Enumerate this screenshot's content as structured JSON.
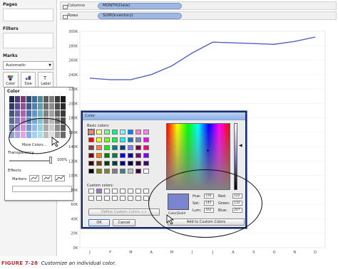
{
  "left": {
    "pages_title": "Pages",
    "filters_title": "Filters",
    "marks_title": "Marks",
    "mark_type": "Automatic",
    "buttons": [
      {
        "label": "Color",
        "icon": "color-palette-icon"
      },
      {
        "label": "Size",
        "icon": "size-icon"
      },
      {
        "label": "Label",
        "icon": "label-icon"
      }
    ]
  },
  "shelves": {
    "columns_label": "Columns",
    "columns_pill": "MONTH(Date)",
    "rows_label": "Rows",
    "rows_pill": "SUM(Inventory)"
  },
  "color_popup": {
    "title": "Color",
    "more_colors": "More Colors...",
    "transparency_label": "Transparency",
    "transparency_value": "100%",
    "effects_label": "Effects",
    "markers_label": "Markers:",
    "palette": [
      "#1f2a44",
      "#4a3a7a",
      "#7a3a7a",
      "#2a4a7a",
      "#3a6ea5",
      "#4a8a9a",
      "#5a5a5a",
      "#7a7a7a",
      "#3a3a3a",
      "#1a1a1a",
      "#2e3d6b",
      "#5a4a9a",
      "#9a4a9a",
      "#3a5a9a",
      "#4a82c0",
      "#5aa0b0",
      "#6e6e6e",
      "#8e8e8e",
      "#4e4e4e",
      "#2a2a2a",
      "#44557f",
      "#7060b0",
      "#b060b0",
      "#4a70b0",
      "#5c96d4",
      "#6ab4c4",
      "#828282",
      "#a2a2a2",
      "#626262",
      "#3a3a3a",
      "#5a6c96",
      "#8674c4",
      "#c476c4",
      "#5e84c4",
      "#70aae6",
      "#7ac6d6",
      "#969696",
      "#b6b6b6",
      "#767676",
      "#4a4a4a",
      "#7286ae",
      "#9c8ad6",
      "#d68cd6",
      "#7298d6",
      "#88bef2",
      "#8cd6e4",
      "#aaaaaa",
      "#cacaca",
      "#8a8a8a",
      "#5a5a5a",
      "#8ea2c6",
      "#b4a2e6",
      "#e6a4e6",
      "#88acea",
      "#a2d0fa",
      "#a0e4f0",
      "#bebebe",
      "#dedede",
      "#9e9e9e",
      "#6a6a6a"
    ]
  },
  "dialog": {
    "title": "Color",
    "basic_label": "Basic colors:",
    "custom_label": "Custom colors:",
    "define_button": "Define Custom Colors >>",
    "ok": "OK",
    "cancel": "Cancel",
    "colorsolid": "Color|Solid",
    "hue_label": "Hue:",
    "hue": "156",
    "sat_label": "Sat:",
    "sat": "145",
    "lum_label": "Lum:",
    "lum": "162",
    "red_label": "Red:",
    "red": "122",
    "green_label": "Green:",
    "green": "132",
    "blue_label": "Blue:",
    "blue": "207",
    "add_button": "Add to Custom Colors",
    "basic_colors": [
      "#ff8080",
      "#ffff80",
      "#80ff80",
      "#00ff80",
      "#80ffff",
      "#0080ff",
      "#ff80c0",
      "#ff80ff",
      "#ff0000",
      "#ffff00",
      "#80ff00",
      "#00ff40",
      "#00ffff",
      "#0080c0",
      "#8080c0",
      "#ff00ff",
      "#804040",
      "#ff8040",
      "#00ff00",
      "#008080",
      "#004080",
      "#8080ff",
      "#800040",
      "#ff0080",
      "#800000",
      "#ff8000",
      "#008000",
      "#008040",
      "#0000ff",
      "#0000a0",
      "#800080",
      "#8000ff",
      "#400000",
      "#804000",
      "#004000",
      "#004040",
      "#000080",
      "#000040",
      "#400040",
      "#400080",
      "#000000",
      "#808000",
      "#808040",
      "#808080",
      "#408080",
      "#c0c0c0",
      "#400040",
      "#ffffff"
    ],
    "custom_colors": [
      "#ffffff",
      "#9a78c8",
      "#ffffff",
      "#ffffff",
      "#ffffff",
      "#ffffff",
      "#ffffff",
      "#ffffff",
      "#ffffff",
      "#ffffff",
      "#ffffff",
      "#ffffff",
      "#ffffff",
      "#ffffff",
      "#ffffff",
      "#ffffff"
    ]
  },
  "chart_data": {
    "type": "line",
    "categories": [
      "J",
      "F",
      "M",
      "A",
      "M",
      "J",
      "J",
      "A",
      "S",
      "O",
      "N",
      "D"
    ],
    "values": [
      235,
      233,
      233,
      240,
      252,
      270,
      285,
      284,
      283,
      282,
      286,
      292
    ],
    "y_ticks": [
      "300K",
      "280K",
      "260K",
      "240K",
      "220K",
      "200K",
      "180K",
      "160K",
      "140K",
      "120K",
      "100K",
      "80K",
      "60K",
      "40K",
      "20K",
      "0K"
    ],
    "ylim": [
      0,
      300
    ],
    "line_color": "#5262c4",
    "grid": true
  },
  "caption": {
    "figure": "FIGURE 7-28",
    "text": "Customize an individual color."
  }
}
